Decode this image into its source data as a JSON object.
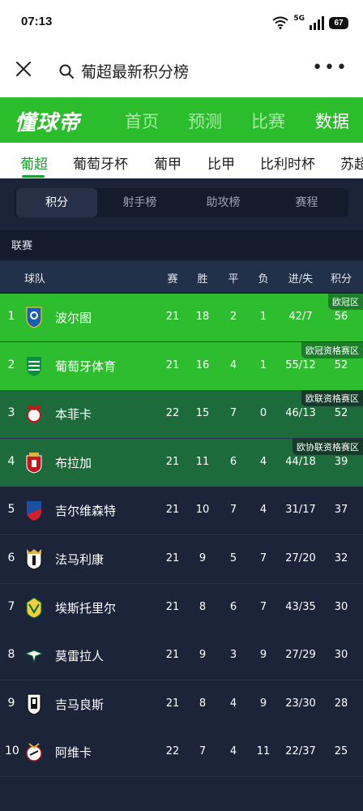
{
  "status_bar": {
    "time": "07:13",
    "network": "5G",
    "battery": "67"
  },
  "top_bar": {
    "title": "葡超最新积分榜",
    "more": "•••"
  },
  "brand": {
    "logo": "懂球帝",
    "nav": [
      "首页",
      "预测",
      "比赛",
      "数据"
    ],
    "active_nav": "数据"
  },
  "leagues": {
    "items": [
      "葡超",
      "葡萄牙杯",
      "葡甲",
      "比甲",
      "比利时杯",
      "苏超"
    ],
    "active": "葡超"
  },
  "tabs": {
    "items": [
      "积分",
      "射手榜",
      "助攻榜",
      "赛程"
    ],
    "active": "积分"
  },
  "section_title": "联赛",
  "table": {
    "headers": {
      "team": "球队",
      "played": "赛",
      "win": "胜",
      "draw": "平",
      "loss": "负",
      "goals": "进/失",
      "points": "积分"
    },
    "rows": [
      {
        "rank": "1",
        "team": "波尔图",
        "played": "21",
        "win": "18",
        "draw": "2",
        "loss": "1",
        "goals": "42/7",
        "points": "56",
        "zone": "欧冠区",
        "crest": "porto-crest-icon"
      },
      {
        "rank": "2",
        "team": "葡萄牙体育",
        "played": "21",
        "win": "16",
        "draw": "4",
        "loss": "1",
        "goals": "55/12",
        "points": "52",
        "zone": "欧冠资格赛区",
        "crest": "sporting-crest-icon"
      },
      {
        "rank": "3",
        "team": "本菲卡",
        "played": "22",
        "win": "15",
        "draw": "7",
        "loss": "0",
        "goals": "46/13",
        "points": "52",
        "zone": "欧联资格赛区",
        "crest": "benfica-crest-icon"
      },
      {
        "rank": "4",
        "team": "布拉加",
        "played": "21",
        "win": "11",
        "draw": "6",
        "loss": "4",
        "goals": "44/18",
        "points": "39",
        "zone": "欧协联资格赛区",
        "crest": "braga-crest-icon"
      },
      {
        "rank": "5",
        "team": "吉尔维森特",
        "played": "21",
        "win": "10",
        "draw": "7",
        "loss": "4",
        "goals": "31/17",
        "points": "37",
        "zone": "",
        "crest": "gil-vicente-crest-icon"
      },
      {
        "rank": "6",
        "team": "法马利康",
        "played": "21",
        "win": "9",
        "draw": "5",
        "loss": "7",
        "goals": "27/20",
        "points": "32",
        "zone": "",
        "crest": "famalicao-crest-icon"
      },
      {
        "rank": "7",
        "team": "埃斯托里尔",
        "played": "21",
        "win": "8",
        "draw": "6",
        "loss": "7",
        "goals": "43/35",
        "points": "30",
        "zone": "",
        "crest": "estoril-crest-icon"
      },
      {
        "rank": "8",
        "team": "莫雷拉人",
        "played": "21",
        "win": "9",
        "draw": "3",
        "loss": "9",
        "goals": "27/29",
        "points": "30",
        "zone": "",
        "crest": "moreirense-crest-icon"
      },
      {
        "rank": "9",
        "team": "吉马良斯",
        "played": "21",
        "win": "8",
        "draw": "4",
        "loss": "9",
        "goals": "23/30",
        "points": "28",
        "zone": "",
        "crest": "guimaraes-crest-icon"
      },
      {
        "rank": "10",
        "team": "阿维卡",
        "played": "22",
        "win": "7",
        "draw": "4",
        "loss": "11",
        "goals": "22/37",
        "points": "25",
        "zone": "",
        "crest": "avs-crest-icon"
      }
    ]
  },
  "colors": {
    "brand_green": "#2bbd2c",
    "cl_zone": "#2dbd2f",
    "qual_zone": "#1d6b3b",
    "background": "#1b2438"
  }
}
